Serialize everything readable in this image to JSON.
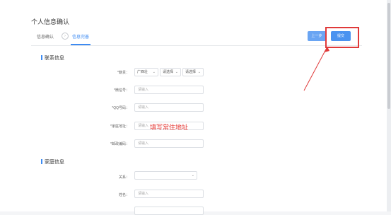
{
  "page": {
    "title": "个人信息确认",
    "steps": [
      "信息确认",
      "信息完善"
    ],
    "step_separator": "›",
    "buttons": {
      "prev": "上一步",
      "submit": "提交"
    }
  },
  "contact": {
    "heading": "联系信息",
    "origin_label": "*籍贯：",
    "origin_selects": [
      "广西壮",
      "请选择",
      "请选择"
    ],
    "wechat_label": "*微信号：",
    "wechat_placeholder": "请输入",
    "qq_label": "*QQ号码：",
    "qq_placeholder": "请输入",
    "address_label": "*家庭地址：",
    "address_placeholder": "请输入",
    "postcode_label": "*邮政编码：",
    "postcode_placeholder": "请输入"
  },
  "family": {
    "heading": "家庭信息",
    "relation_label": "关系：",
    "relation_value": "",
    "name_label": "姓名：",
    "name_placeholder": "请输入"
  },
  "annotation": {
    "text": "填写常住地址",
    "color": "#e53935"
  },
  "colors": {
    "accent": "#3d8bf2",
    "highlight": "#e03a3a"
  }
}
